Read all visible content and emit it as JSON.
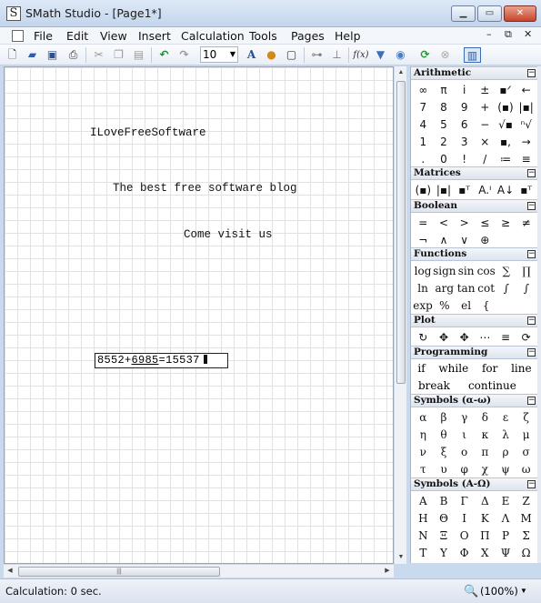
{
  "window": {
    "title": "SMath Studio - [Page1*]",
    "app_icon_letter": "S",
    "min": "▁",
    "max": "▭",
    "close": "✕"
  },
  "menu": {
    "items": [
      "File",
      "Edit",
      "View",
      "Insert",
      "Calculation",
      "Tools",
      "Pages",
      "Help"
    ],
    "mdi_min": "–",
    "mdi_restore": "⧉",
    "mdi_close": "✕"
  },
  "toolbar": {
    "font_size": "10",
    "fx_label": "f(x)",
    "icons": [
      "new-icon",
      "open-icon",
      "save-icon",
      "print-icon",
      "cut-icon",
      "copy-icon",
      "paste-icon",
      "undo-icon",
      "redo-icon",
      "text-color-icon",
      "fill-color-icon",
      "border-icon",
      "align-horizontal-icon",
      "align-vertical-icon",
      "insert-function-icon",
      "filter-icon",
      "plugin-icon",
      "recalculate-icon",
      "stop-icon",
      "sidebar-toggle-icon"
    ]
  },
  "sheet": {
    "text1": "ILoveFreeSoftware",
    "text2": "The best free software blog",
    "text3": "Come visit us",
    "math": {
      "a": "8552",
      "op": "+",
      "b": "6985",
      "eq": "=",
      "result": "15537"
    }
  },
  "panel": {
    "arithmetic": {
      "title": "Arithmetic",
      "cells": [
        "∞",
        "π",
        "i",
        "±",
        "▪ᐟ",
        "←",
        "7",
        "8",
        "9",
        "+",
        "(▪)",
        "|▪|",
        "4",
        "5",
        "6",
        "−",
        "√▪",
        "ⁿ√",
        "1",
        "2",
        "3",
        "×",
        "▪,",
        "→",
        ".",
        "0",
        "!",
        "/",
        "≔",
        "≡"
      ]
    },
    "matrices": {
      "title": "Matrices",
      "cells": [
        "(▪)",
        "|▪|",
        "▪ᵀ",
        "A.ᴵ",
        "A↓",
        "▪ᵀ"
      ]
    },
    "boolean": {
      "title": "Boolean",
      "cells": [
        "=",
        "<",
        ">",
        "≤",
        "≥",
        "≠",
        "¬",
        "∧",
        "∨",
        "⊕"
      ]
    },
    "functions": {
      "title": "Functions",
      "cells": [
        "log",
        "sign",
        "sin",
        "cos",
        "∑",
        "∏",
        "ln",
        "arg",
        "tan",
        "cot",
        "∫",
        "∫",
        "exp",
        "%",
        "el",
        "{"
      ]
    },
    "plot": {
      "title": "Plot",
      "cells": [
        "↻",
        "✥",
        "✥",
        "⋯",
        "≡",
        "⟳"
      ]
    },
    "programming": {
      "title": "Programming",
      "row1": [
        "if",
        "while",
        "for",
        "line"
      ],
      "row2": [
        "break",
        "continue"
      ]
    },
    "greek_lower": {
      "title": "Symbols (α-ω)",
      "cells": [
        "α",
        "β",
        "γ",
        "δ",
        "ε",
        "ζ",
        "η",
        "θ",
        "ι",
        "κ",
        "λ",
        "μ",
        "ν",
        "ξ",
        "ο",
        "π",
        "ρ",
        "σ",
        "τ",
        "υ",
        "φ",
        "χ",
        "ψ",
        "ω"
      ]
    },
    "greek_upper": {
      "title": "Symbols (A-Ω)",
      "cells": [
        "Α",
        "Β",
        "Γ",
        "Δ",
        "Ε",
        "Ζ",
        "Η",
        "Θ",
        "Ι",
        "Κ",
        "Λ",
        "Μ",
        "Ν",
        "Ξ",
        "Ο",
        "Π",
        "Ρ",
        "Σ",
        "Τ",
        "Υ",
        "Φ",
        "Χ",
        "Ψ",
        "Ω"
      ]
    }
  },
  "status": {
    "text": "Calculation: 0 sec.",
    "zoom": "(100%)"
  }
}
